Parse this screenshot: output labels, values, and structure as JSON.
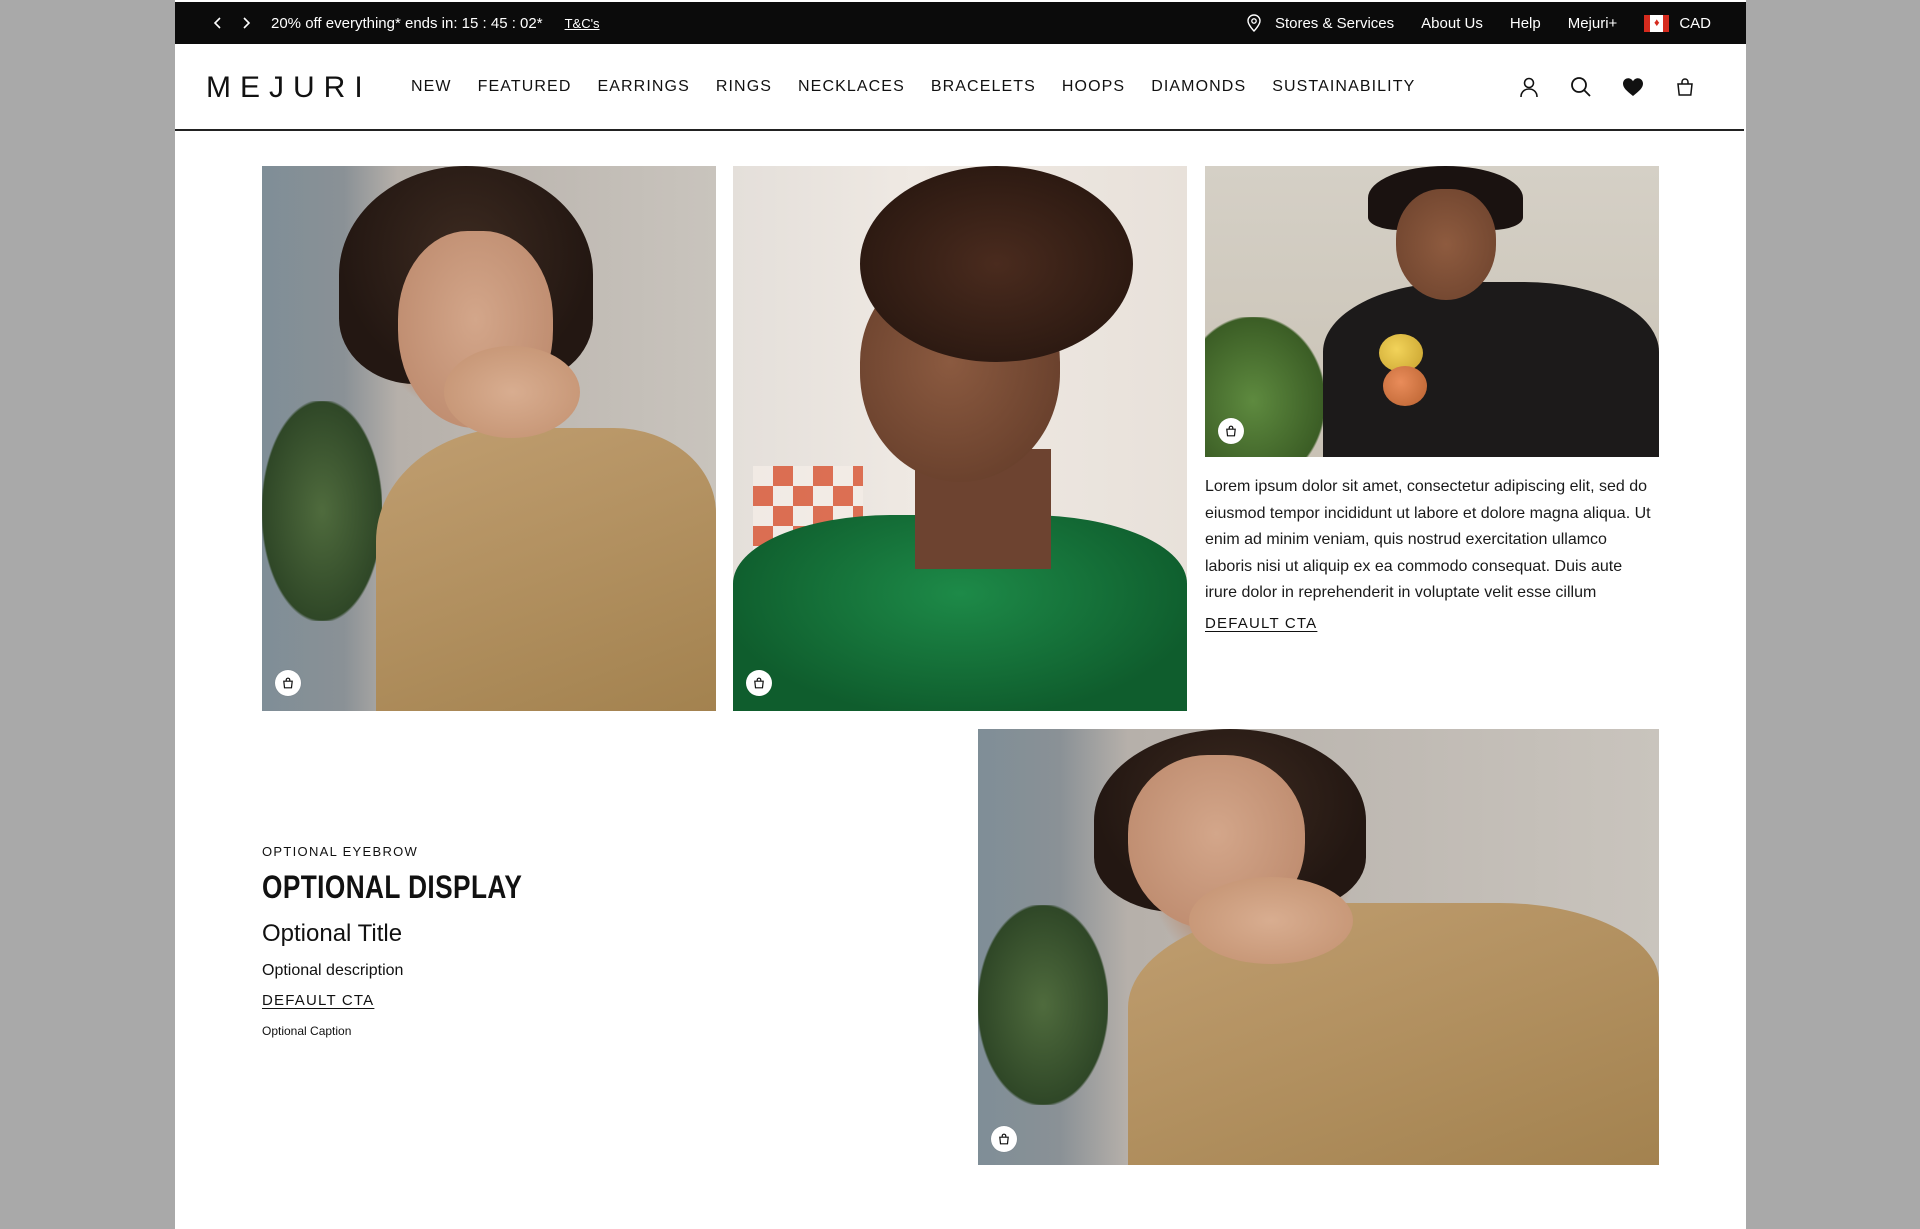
{
  "promo": {
    "message": "20% off everything* ends in: 15 : 45 : 02*",
    "terms_link": "T&C's",
    "links": [
      "Stores & Services",
      "About Us",
      "Help",
      "Mejuri+"
    ],
    "currency": "CAD"
  },
  "header": {
    "logo": "MEJURI",
    "nav": [
      "NEW",
      "FEATURED",
      "EARRINGS",
      "RINGS",
      "NECKLACES",
      "BRACELETS",
      "HOOPS",
      "DIAMONDS",
      "SUSTAINABILITY"
    ]
  },
  "editorial": {
    "body": "Lorem ipsum dolor sit amet, consectetur adipiscing elit, sed do eiusmod tempor incididunt ut labore et dolore magna aliqua. Ut enim ad minim veniam, quis nostrud exercitation ullamco laboris nisi ut aliquip ex ea commodo consequat. Duis aute irure dolor in reprehenderit in voluptate velit esse cillum",
    "cta": "DEFAULT CTA"
  },
  "feature": {
    "eyebrow": "OPTIONAL EYEBROW",
    "display": "OPTIONAL DISPLAY",
    "title": "Optional Title",
    "description": "Optional description",
    "cta": "DEFAULT CTA",
    "caption": "Optional Caption"
  },
  "colors": {
    "promo_bg": "#0b0b0b",
    "page_bg": "#ffffff",
    "backdrop": "#a9a9a9",
    "flag_red": "#d52b1e"
  }
}
